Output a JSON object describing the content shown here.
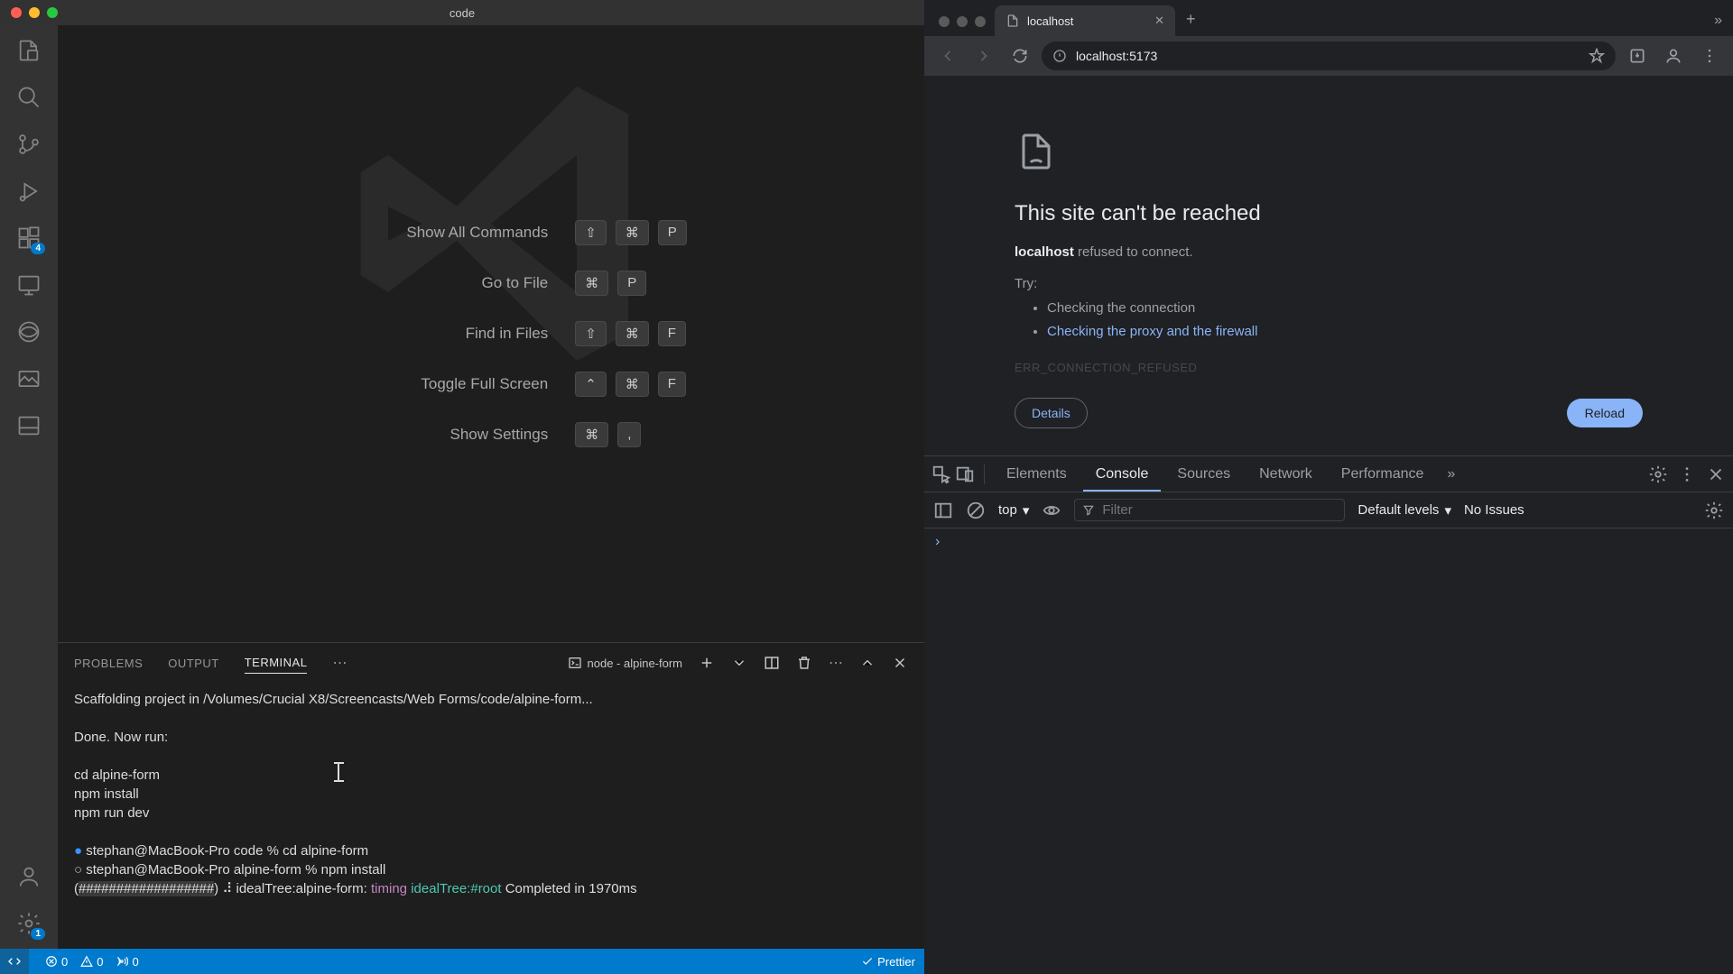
{
  "vscode": {
    "title": "code",
    "welcome": [
      {
        "label": "Show All Commands",
        "keys": [
          "⇧",
          "⌘",
          "P"
        ]
      },
      {
        "label": "Go to File",
        "keys": [
          "⌘",
          "P"
        ]
      },
      {
        "label": "Find in Files",
        "keys": [
          "⇧",
          "⌘",
          "F"
        ]
      },
      {
        "label": "Toggle Full Screen",
        "keys": [
          "⌃",
          "⌘",
          "F"
        ]
      },
      {
        "label": "Show Settings",
        "keys": [
          "⌘",
          ","
        ]
      }
    ],
    "extensions_badge": "4",
    "settings_badge": "1",
    "panel_tabs": {
      "problems": "PROBLEMS",
      "output": "OUTPUT",
      "terminal": "TERMINAL"
    },
    "terminal_label": "node - alpine-form",
    "terminal_lines": {
      "scaffold": "Scaffolding project in /Volumes/Crucial X8/Screencasts/Web Forms/code/alpine-form...",
      "done": "Done. Now run:",
      "cd": "  cd alpine-form",
      "install": "  npm install",
      "dev": "  npm run dev",
      "prompt1_user": "stephan@MacBook-Pro",
      "prompt1_dir": "code",
      "prompt1_cmd": "cd alpine-form",
      "prompt2_user": "stephan@MacBook-Pro",
      "prompt2_dir": "alpine-form",
      "prompt2_cmd": "npm install",
      "progress_prefix": "(",
      "progress_bar": "##################",
      "progress_suffix": ") ⠼ idealTree:alpine-form:",
      "timing": "timing",
      "idealtree": "idealTree:#root",
      "completed": "Completed in 1970ms"
    },
    "status": {
      "errors": "0",
      "warnings": "0",
      "ports": "0",
      "prettier": "Prettier"
    }
  },
  "chrome": {
    "tab_title": "localhost",
    "url": "localhost:5173",
    "error": {
      "title": "This site can't be reached",
      "host": "localhost",
      "msg": " refused to connect.",
      "try": "Try:",
      "tip1": "Checking the connection",
      "tip2": "Checking the proxy and the firewall",
      "code": "ERR_CONNECTION_REFUSED",
      "details": "Details",
      "reload": "Reload"
    },
    "devtools": {
      "tabs": {
        "elements": "Elements",
        "console": "Console",
        "sources": "Sources",
        "network": "Network",
        "performance": "Performance"
      },
      "context": "top",
      "filter_placeholder": "Filter",
      "levels": "Default levels",
      "issues": "No Issues"
    }
  }
}
